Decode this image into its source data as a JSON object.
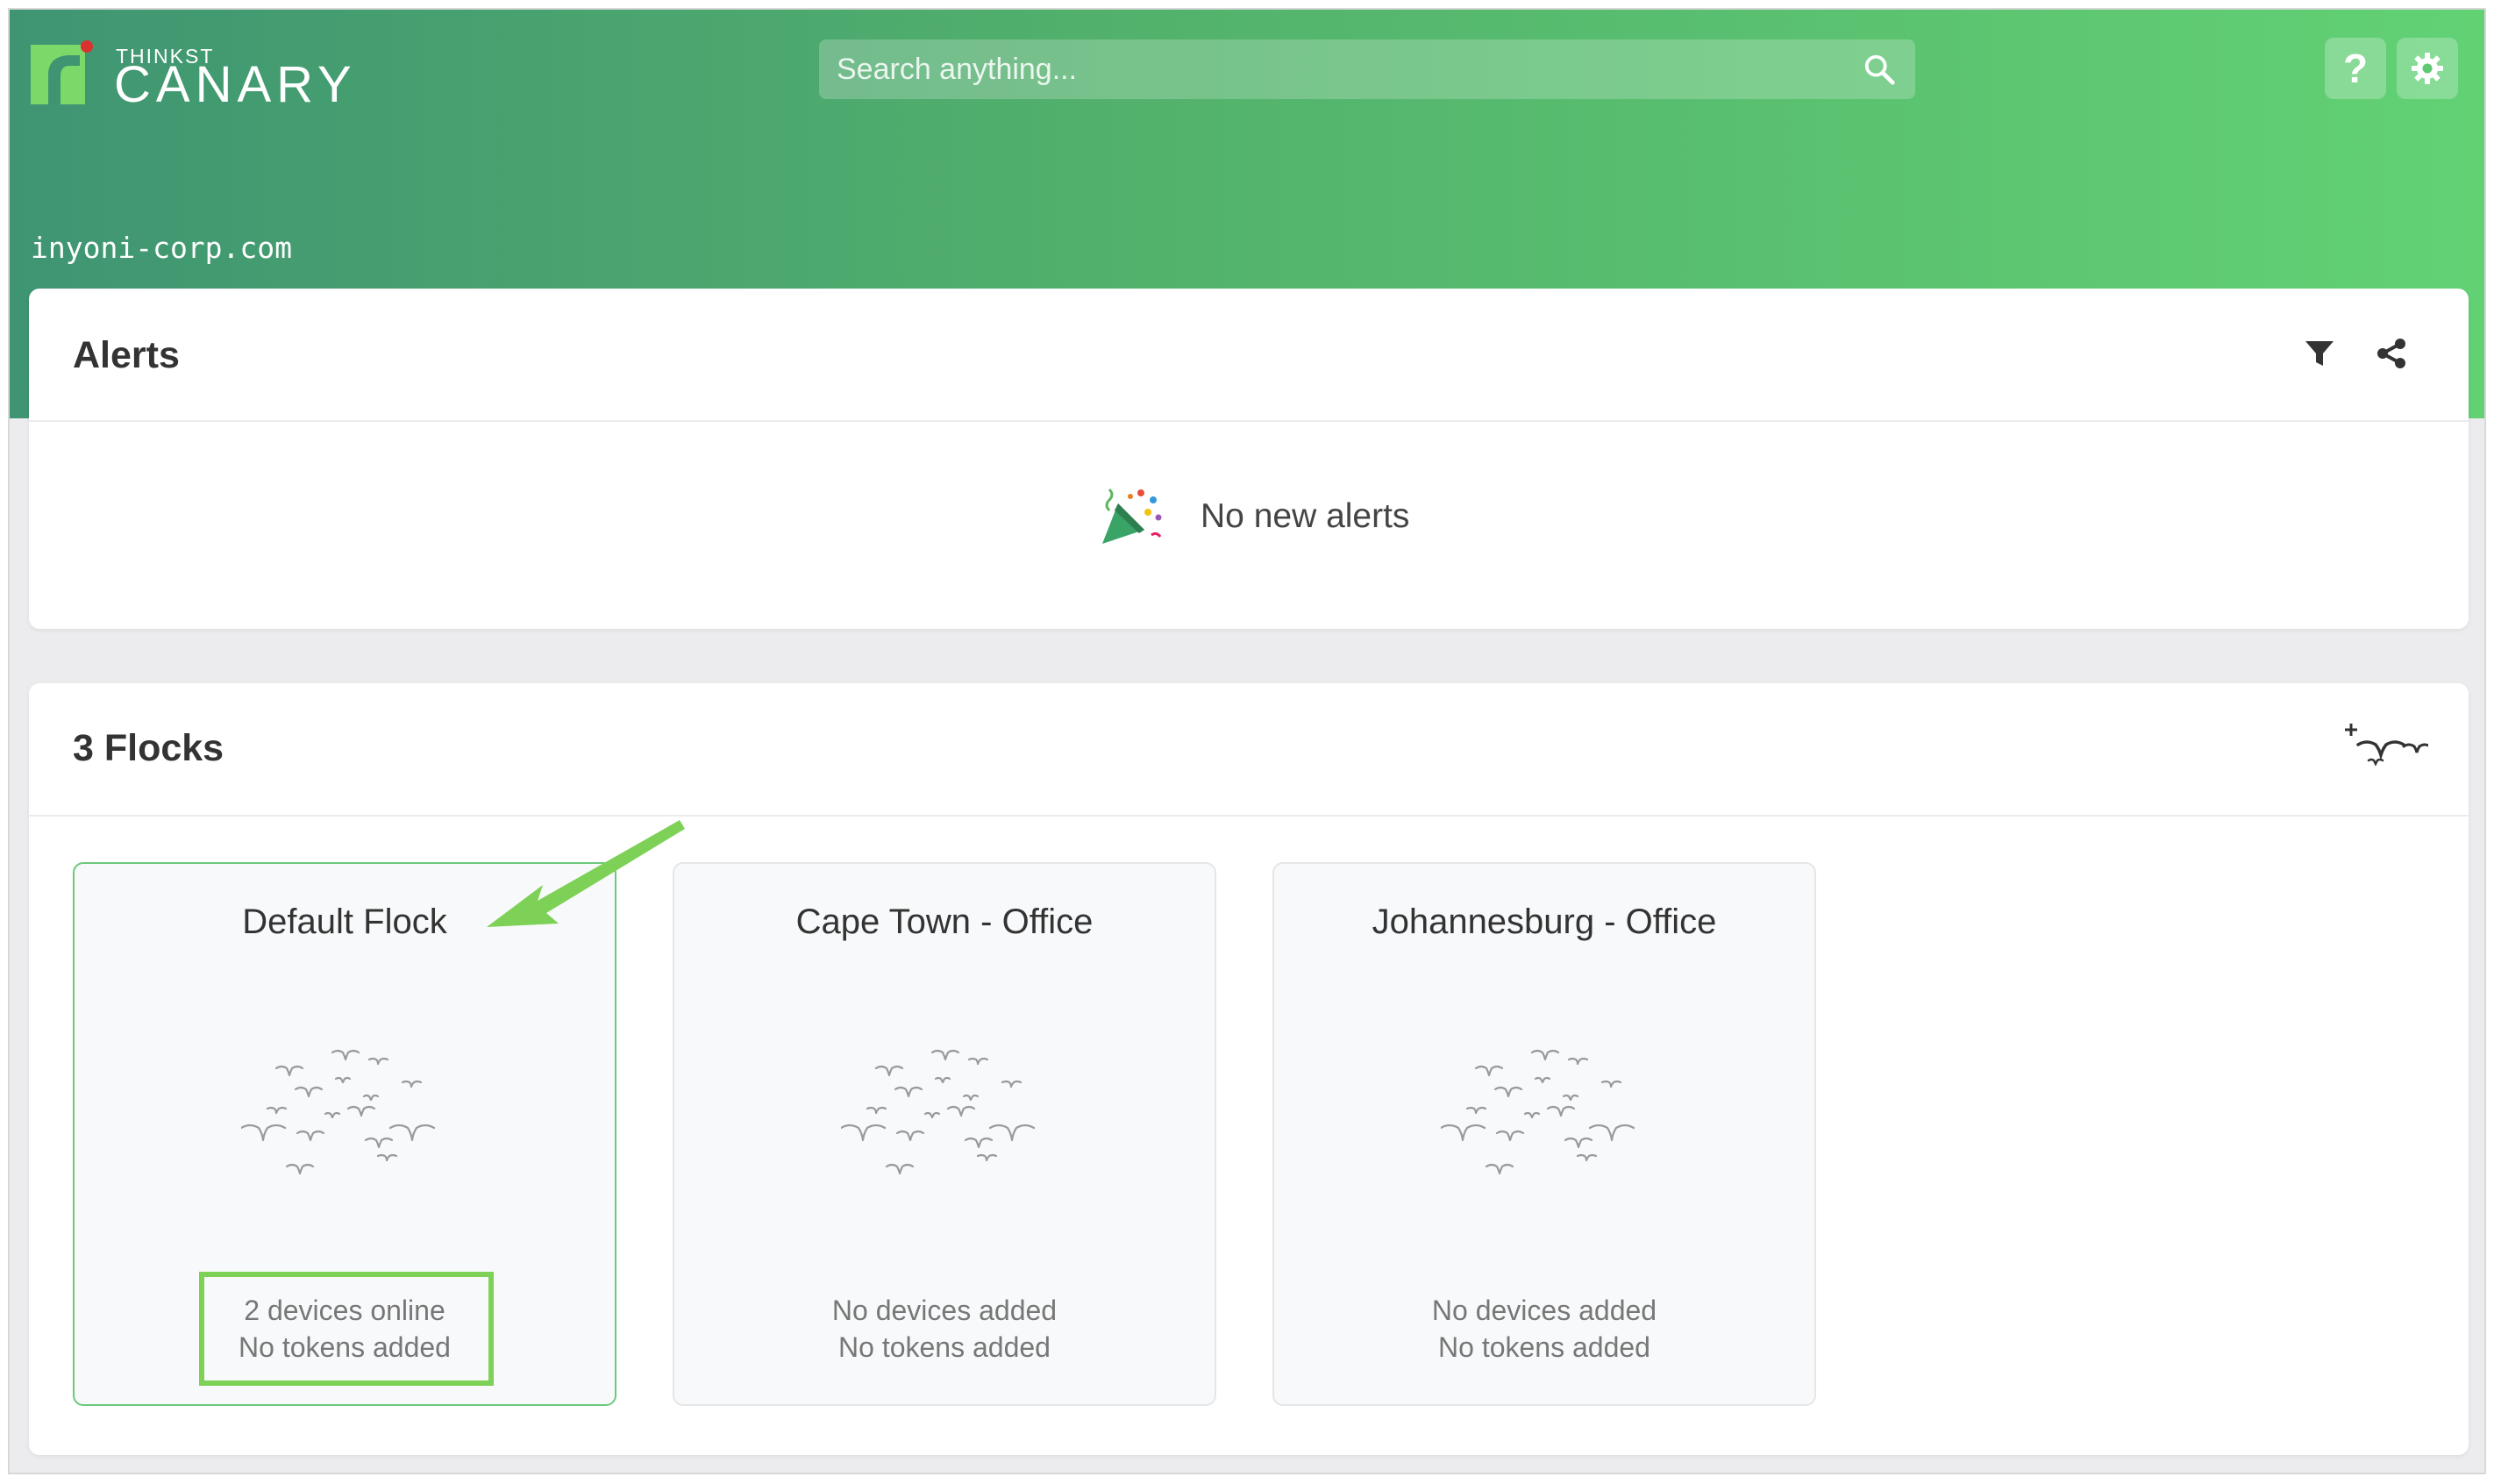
{
  "header": {
    "brand_small": "THINKST",
    "brand_name": "CANARY",
    "search_placeholder": "Search anything...",
    "help_label": "?",
    "domain": "inyoni-corp.com"
  },
  "colors": {
    "header_gradient_start": "#3f9572",
    "header_gradient_end": "#62d174",
    "accent_green": "#7dd156",
    "logo_green": "#7bd869",
    "logo_red": "#d9322f"
  },
  "alerts": {
    "title": "Alerts",
    "empty_message": "No new alerts",
    "icons": [
      "filter-icon",
      "share-icon",
      "party-popper-icon"
    ]
  },
  "flocks": {
    "title": "3 Flocks",
    "add_icon": "add-flock-icon",
    "items": [
      {
        "name": "Default Flock",
        "devices": "2 devices online",
        "tokens": "No tokens added",
        "selected": true
      },
      {
        "name": "Cape Town - Office",
        "devices": "No devices added",
        "tokens": "No tokens added",
        "selected": false
      },
      {
        "name": "Johannesburg - Office",
        "devices": "No devices added",
        "tokens": "No tokens added",
        "selected": false
      }
    ]
  }
}
